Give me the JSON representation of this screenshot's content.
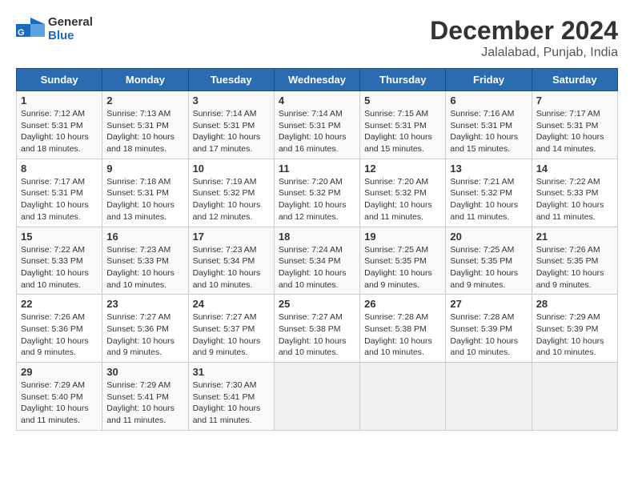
{
  "header": {
    "logo_general": "General",
    "logo_blue": "Blue",
    "title": "December 2024",
    "subtitle": "Jalalabad, Punjab, India"
  },
  "weekdays": [
    "Sunday",
    "Monday",
    "Tuesday",
    "Wednesday",
    "Thursday",
    "Friday",
    "Saturday"
  ],
  "weeks": [
    [
      {
        "day": "1",
        "sunrise": "7:12 AM",
        "sunset": "5:31 PM",
        "daylight": "10 hours and 18 minutes."
      },
      {
        "day": "2",
        "sunrise": "7:13 AM",
        "sunset": "5:31 PM",
        "daylight": "10 hours and 18 minutes."
      },
      {
        "day": "3",
        "sunrise": "7:14 AM",
        "sunset": "5:31 PM",
        "daylight": "10 hours and 17 minutes."
      },
      {
        "day": "4",
        "sunrise": "7:14 AM",
        "sunset": "5:31 PM",
        "daylight": "10 hours and 16 minutes."
      },
      {
        "day": "5",
        "sunrise": "7:15 AM",
        "sunset": "5:31 PM",
        "daylight": "10 hours and 15 minutes."
      },
      {
        "day": "6",
        "sunrise": "7:16 AM",
        "sunset": "5:31 PM",
        "daylight": "10 hours and 15 minutes."
      },
      {
        "day": "7",
        "sunrise": "7:17 AM",
        "sunset": "5:31 PM",
        "daylight": "10 hours and 14 minutes."
      }
    ],
    [
      {
        "day": "8",
        "sunrise": "7:17 AM",
        "sunset": "5:31 PM",
        "daylight": "10 hours and 13 minutes."
      },
      {
        "day": "9",
        "sunrise": "7:18 AM",
        "sunset": "5:31 PM",
        "daylight": "10 hours and 13 minutes."
      },
      {
        "day": "10",
        "sunrise": "7:19 AM",
        "sunset": "5:32 PM",
        "daylight": "10 hours and 12 minutes."
      },
      {
        "day": "11",
        "sunrise": "7:20 AM",
        "sunset": "5:32 PM",
        "daylight": "10 hours and 12 minutes."
      },
      {
        "day": "12",
        "sunrise": "7:20 AM",
        "sunset": "5:32 PM",
        "daylight": "10 hours and 11 minutes."
      },
      {
        "day": "13",
        "sunrise": "7:21 AM",
        "sunset": "5:32 PM",
        "daylight": "10 hours and 11 minutes."
      },
      {
        "day": "14",
        "sunrise": "7:22 AM",
        "sunset": "5:33 PM",
        "daylight": "10 hours and 11 minutes."
      }
    ],
    [
      {
        "day": "15",
        "sunrise": "7:22 AM",
        "sunset": "5:33 PM",
        "daylight": "10 hours and 10 minutes."
      },
      {
        "day": "16",
        "sunrise": "7:23 AM",
        "sunset": "5:33 PM",
        "daylight": "10 hours and 10 minutes."
      },
      {
        "day": "17",
        "sunrise": "7:23 AM",
        "sunset": "5:34 PM",
        "daylight": "10 hours and 10 minutes."
      },
      {
        "day": "18",
        "sunrise": "7:24 AM",
        "sunset": "5:34 PM",
        "daylight": "10 hours and 10 minutes."
      },
      {
        "day": "19",
        "sunrise": "7:25 AM",
        "sunset": "5:35 PM",
        "daylight": "10 hours and 9 minutes."
      },
      {
        "day": "20",
        "sunrise": "7:25 AM",
        "sunset": "5:35 PM",
        "daylight": "10 hours and 9 minutes."
      },
      {
        "day": "21",
        "sunrise": "7:26 AM",
        "sunset": "5:35 PM",
        "daylight": "10 hours and 9 minutes."
      }
    ],
    [
      {
        "day": "22",
        "sunrise": "7:26 AM",
        "sunset": "5:36 PM",
        "daylight": "10 hours and 9 minutes."
      },
      {
        "day": "23",
        "sunrise": "7:27 AM",
        "sunset": "5:36 PM",
        "daylight": "10 hours and 9 minutes."
      },
      {
        "day": "24",
        "sunrise": "7:27 AM",
        "sunset": "5:37 PM",
        "daylight": "10 hours and 9 minutes."
      },
      {
        "day": "25",
        "sunrise": "7:27 AM",
        "sunset": "5:38 PM",
        "daylight": "10 hours and 10 minutes."
      },
      {
        "day": "26",
        "sunrise": "7:28 AM",
        "sunset": "5:38 PM",
        "daylight": "10 hours and 10 minutes."
      },
      {
        "day": "27",
        "sunrise": "7:28 AM",
        "sunset": "5:39 PM",
        "daylight": "10 hours and 10 minutes."
      },
      {
        "day": "28",
        "sunrise": "7:29 AM",
        "sunset": "5:39 PM",
        "daylight": "10 hours and 10 minutes."
      }
    ],
    [
      {
        "day": "29",
        "sunrise": "7:29 AM",
        "sunset": "5:40 PM",
        "daylight": "10 hours and 11 minutes."
      },
      {
        "day": "30",
        "sunrise": "7:29 AM",
        "sunset": "5:41 PM",
        "daylight": "10 hours and 11 minutes."
      },
      {
        "day": "31",
        "sunrise": "7:30 AM",
        "sunset": "5:41 PM",
        "daylight": "10 hours and 11 minutes."
      },
      null,
      null,
      null,
      null
    ]
  ]
}
